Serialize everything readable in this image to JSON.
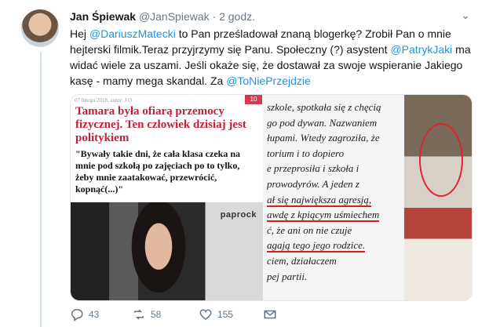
{
  "tweet": {
    "author_name": "Jan Śpiewak",
    "author_handle": "@JanSpiewak",
    "separator": "·",
    "time": "2 godz.",
    "text_part1": "Hej ",
    "mention1": "@DariuszMatecki",
    "text_part2": " to Pan prześladował znaną blogerkę? Zrobił Pan o mnie hejterski filmik.Teraz przyjrzymy się Panu. Społeczny (?) asystent ",
    "mention2": "@PatrykJaki",
    "text_part3": " ma widać wiele za uszami. Jeśli okaże się, że dostawał za swoje wspieranie Jakiego kasę - mamy mega skandal. Za ",
    "mention3": "@ToNiePrzejdzie"
  },
  "media": {
    "date": "07 lutego 2018, autor: J.O",
    "badge": "10",
    "headline": "Tamara była ofiarą przemocy fizycznej. Ten człowiek dzisiaj jest politykiem",
    "quote": "\"Bywały takie dni, że cała klasa czeka na mnie pod szkołą po zajęciach po to tylko, żeby mnie zaatakować, przewrócić, kopnąć(...)\"",
    "photo_brand": "paprock",
    "mid_lines": [
      "szkole, spotkała się z chęcią",
      "go pod dywan. Nazwaniem",
      "łupami. Wtedy zagroziła, że",
      "torium i to dopiero",
      "e przeprosiła i szkoła i",
      "prowodyrów. A jeden z",
      "ał się największa agresją,",
      "awdę z kpiącym uśmiechem",
      "ć, że ani on nie czuje",
      "agają tego jego rodzice.",
      "ciem, działaczem",
      "pej partii."
    ]
  },
  "actions": {
    "replies": "43",
    "retweets": "58",
    "likes": "155"
  },
  "colors": {
    "link": "#1b95e0",
    "muted": "#657786"
  }
}
